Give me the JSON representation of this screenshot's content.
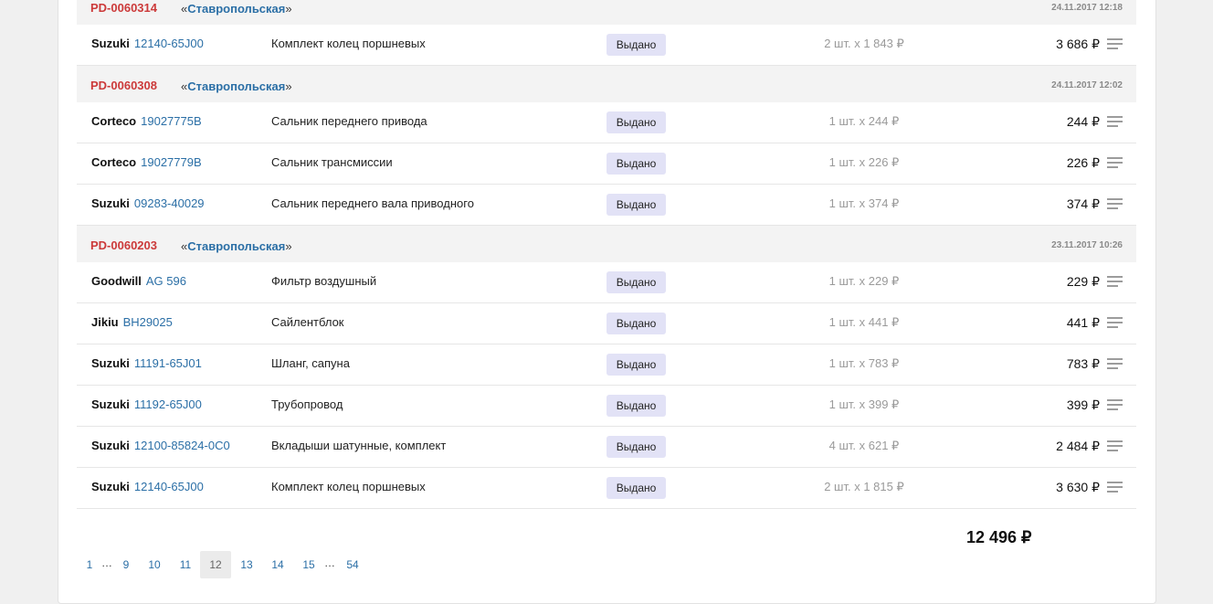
{
  "orders": [
    {
      "id": "PD-0060314",
      "store_prefix": "«",
      "store": "Ставропольская",
      "store_suffix": "»",
      "date": "24.11.2017 12:18",
      "items": [
        {
          "brand": "Suzuki",
          "sku": "12140-65J00",
          "desc": "Комплект колец поршневых",
          "status": "Выдано",
          "qty": "2 шт. x 1 843 ₽",
          "total": "3 686 ₽"
        }
      ]
    },
    {
      "id": "PD-0060308",
      "store_prefix": "«",
      "store": "Ставропольская",
      "store_suffix": "»",
      "date": "24.11.2017 12:02",
      "items": [
        {
          "brand": "Corteco",
          "sku": "19027775B",
          "desc": "Сальник переднего привода",
          "status": "Выдано",
          "qty": "1 шт. x 244 ₽",
          "total": "244 ₽"
        },
        {
          "brand": "Corteco",
          "sku": "19027779B",
          "desc": "Сальник трансмиссии",
          "status": "Выдано",
          "qty": "1 шт. x 226 ₽",
          "total": "226 ₽"
        },
        {
          "brand": "Suzuki",
          "sku": "09283-40029",
          "desc": "Сальник переднего вала приводного",
          "status": "Выдано",
          "qty": "1 шт. x 374 ₽",
          "total": "374 ₽"
        }
      ]
    },
    {
      "id": "PD-0060203",
      "store_prefix": "«",
      "store": "Ставропольская",
      "store_suffix": "»",
      "date": "23.11.2017 10:26",
      "items": [
        {
          "brand": "Goodwill",
          "sku": "AG 596",
          "desc": "Фильтр воздушный",
          "status": "Выдано",
          "qty": "1 шт. x 229 ₽",
          "total": "229 ₽"
        },
        {
          "brand": "Jikiu",
          "sku": "BH29025",
          "desc": "Сайлентблок",
          "status": "Выдано",
          "qty": "1 шт. x 441 ₽",
          "total": "441 ₽"
        },
        {
          "brand": "Suzuki",
          "sku": "11191-65J01",
          "desc": "Шланг, сапуна",
          "status": "Выдано",
          "qty": "1 шт. x 783 ₽",
          "total": "783 ₽"
        },
        {
          "brand": "Suzuki",
          "sku": "11192-65J00",
          "desc": "Трубопровод",
          "status": "Выдано",
          "qty": "1 шт. x 399 ₽",
          "total": "399 ₽"
        },
        {
          "brand": "Suzuki",
          "sku": "12100-85824-0C0",
          "desc": "Вкладыши шатунные, комплект",
          "status": "Выдано",
          "qty": "4 шт. x 621 ₽",
          "total": "2 484 ₽"
        },
        {
          "brand": "Suzuki",
          "sku": "12140-65J00",
          "desc": "Комплект колец поршневых",
          "status": "Выдано",
          "qty": "2 шт. x 1 815 ₽",
          "total": "3 630 ₽"
        }
      ]
    }
  ],
  "summary": {
    "grand_total": "12 496 ₽"
  },
  "pagination": {
    "pages": [
      "1",
      "9",
      "10",
      "11",
      "12",
      "13",
      "14",
      "15",
      "54"
    ],
    "current": "12",
    "ellipsis": "…"
  },
  "icons": {
    "row_menu": "menu-lines-icon"
  },
  "colors": {
    "order_id": "#cc3a3a",
    "link": "#2b6fa6",
    "status_bg": "#e2e2f6",
    "header_bg": "#f3f3f3"
  }
}
